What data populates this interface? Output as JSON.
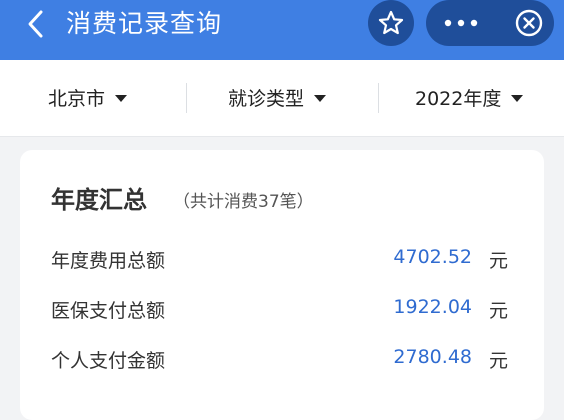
{
  "header": {
    "title": "消费记录查询",
    "back_icon": "chevron-left-icon",
    "favorite_icon": "star-outline-icon",
    "more_icon": "more-dots-icon",
    "close_icon": "close-circle-icon",
    "bar_color": "#3f7fe3",
    "capsule_color": "#1f4e9a"
  },
  "filters": [
    {
      "label": "北京市"
    },
    {
      "label": "就诊类型"
    },
    {
      "label": "2022年度"
    }
  ],
  "summary": {
    "title": "年度汇总",
    "subtitle": "（共计消费37笔）",
    "rows": [
      {
        "label": "年度费用总额",
        "value": "4702.52",
        "unit": "元"
      },
      {
        "label": "医保支付总额",
        "value": "1922.04",
        "unit": "元"
      },
      {
        "label": "个人支付金额",
        "value": "2780.48",
        "unit": "元"
      }
    ],
    "value_color": "#2f6bd0"
  }
}
